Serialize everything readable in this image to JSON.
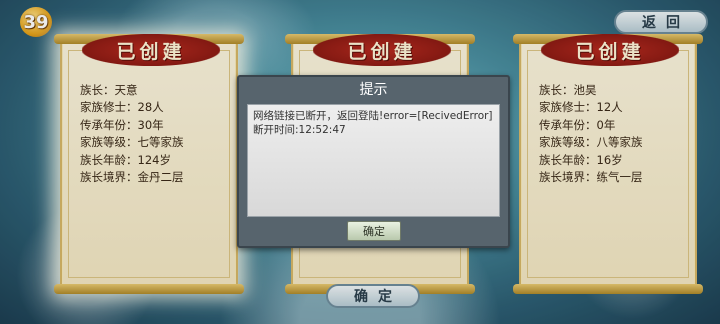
{
  "hud": {
    "level": "39"
  },
  "back_button": {
    "label": "返回"
  },
  "cards": [
    {
      "title": "已创建",
      "rows": [
        "族长：天意",
        "家族修士：28人",
        "传承年份：30年",
        "家族等级：七等家族",
        "族长年龄：124岁",
        "族长境界：金丹二层"
      ]
    },
    {
      "title": "已创建",
      "rows": []
    },
    {
      "title": "已创建",
      "rows": [
        "族长：池昊",
        "家族修士：12人",
        "传承年份：0年",
        "家族等级：八等家族",
        "族长年龄：16岁",
        "族长境界：练气一层"
      ]
    }
  ],
  "confirm_button": {
    "label": "确定"
  },
  "dialog": {
    "title": "提示",
    "message_line1": "网络链接已断开，返回登陆!error=[RecivedError]",
    "message_line2": "断开时间:12:52:47",
    "ok_label": "确定"
  }
}
